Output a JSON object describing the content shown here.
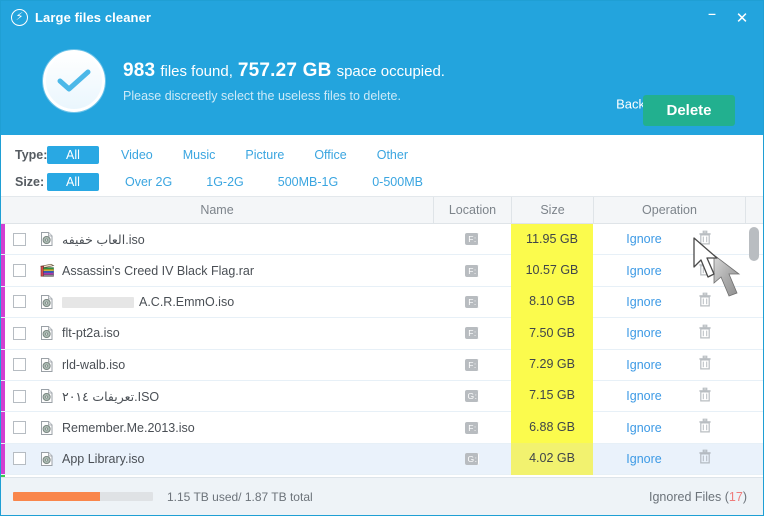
{
  "window": {
    "title": "Large files cleaner",
    "app_icon": "bolt-circle-icon",
    "minimize_label": "–",
    "close_label": "✕",
    "accent_color": "#23a4dd",
    "delete_color": "#22b08f"
  },
  "header": {
    "status_icon": "check-circle-icon",
    "count": "983",
    "found_text": "files found,",
    "size": "757.27 GB",
    "occupied_text": "space occupied.",
    "subtitle": "Please discreetly select the useless files to delete.",
    "back_label": "Back",
    "delete_label": "Delete"
  },
  "filters": {
    "type_label": "Type:",
    "type_options": [
      "All",
      "Video",
      "Music",
      "Picture",
      "Office",
      "Other"
    ],
    "type_selected": "All",
    "size_label": "Size:",
    "size_options": [
      "All",
      "Over 2G",
      "1G-2G",
      "500MB-1G",
      "0-500MB"
    ],
    "size_selected": "All"
  },
  "table": {
    "columns": [
      "Name",
      "Location",
      "Size",
      "Operation"
    ],
    "size_highlight_color": "#fbfb4d",
    "rows": [
      {
        "name": "العاب خفيفه.iso",
        "icon": "iso-disc-icon",
        "redacted": false,
        "location": "F:",
        "size": "11.95 GB",
        "action": "Ignore",
        "delete_icon": "trash-icon",
        "checked": false,
        "selected": false
      },
      {
        "name": "Assassin's Creed IV Black Flag.rar",
        "icon": "rar-archive-icon",
        "redacted": false,
        "location": "F:",
        "size": "10.57 GB",
        "action": "Ignore",
        "delete_icon": "trash-icon",
        "checked": false,
        "selected": false
      },
      {
        "name": "A.C.R.EmmO.iso",
        "icon": "iso-disc-icon",
        "redacted": true,
        "location": "F:",
        "size": "8.10 GB",
        "action": "Ignore",
        "delete_icon": "trash-icon",
        "checked": false,
        "selected": false
      },
      {
        "name": "flt-pt2a.iso",
        "icon": "iso-disc-icon",
        "redacted": false,
        "location": "F:",
        "size": "7.50 GB",
        "action": "Ignore",
        "delete_icon": "trash-icon",
        "checked": false,
        "selected": false
      },
      {
        "name": "rld-walb.iso",
        "icon": "iso-disc-icon",
        "redacted": false,
        "location": "F:",
        "size": "7.29 GB",
        "action": "Ignore",
        "delete_icon": "trash-icon",
        "checked": false,
        "selected": false
      },
      {
        "name": "تعريفات ٢٠١٤.ISO",
        "icon": "iso-disc-icon",
        "redacted": false,
        "location": "G:",
        "size": "7.15 GB",
        "action": "Ignore",
        "delete_icon": "trash-icon",
        "checked": false,
        "selected": false
      },
      {
        "name": "Remember.Me.2013.iso",
        "icon": "iso-disc-icon",
        "redacted": false,
        "location": "F:",
        "size": "6.88 GB",
        "action": "Ignore",
        "delete_icon": "trash-icon",
        "checked": false,
        "selected": false
      },
      {
        "name": "App Library.iso",
        "icon": "iso-disc-icon",
        "redacted": false,
        "location": "G:",
        "size": "4.02 GB",
        "action": "Ignore",
        "delete_icon": "trash-icon",
        "checked": false,
        "selected": true
      }
    ]
  },
  "footer": {
    "used": "1.15 TB",
    "used_word": "used/",
    "total": "1.87 TB",
    "total_word": "total",
    "usage_text": "1.15 TB  used/  1.87 TB  total",
    "progress_percent": 62,
    "progress_color": "#f9864b",
    "ignored_label": "Ignored Files",
    "ignored_open": "(",
    "ignored_count": "17",
    "ignored_close": ")"
  }
}
